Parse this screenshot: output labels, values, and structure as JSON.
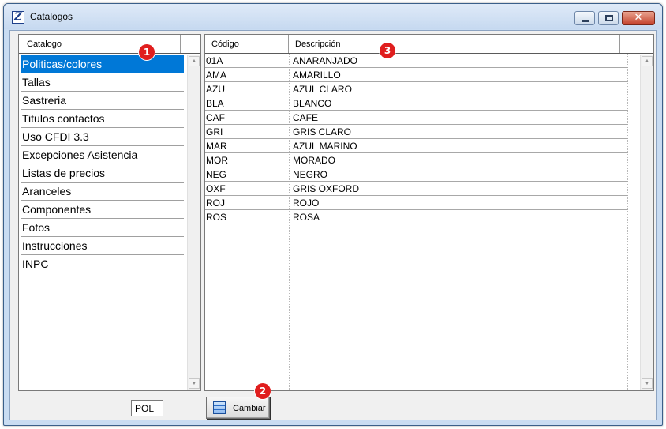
{
  "window": {
    "title": "Catalogos",
    "icon": "app-z-icon"
  },
  "left_panel": {
    "header": "Catalogo",
    "items": [
      "Politicas/colores",
      "Tallas",
      "Sastreria",
      "Titulos contactos",
      "Uso CFDI 3.3",
      "Excepciones Asistencia",
      "Listas de precios",
      "Aranceles",
      "Componentes",
      "Fotos",
      "Instrucciones",
      "INPC"
    ],
    "selected_index": 0
  },
  "grid": {
    "columns": [
      "Código",
      "Descripción"
    ],
    "rows": [
      [
        "01A",
        "ANARANJADO"
      ],
      [
        "AMA",
        "AMARILLO"
      ],
      [
        "AZU",
        "AZUL CLARO"
      ],
      [
        "BLA",
        "BLANCO"
      ],
      [
        "CAF",
        "CAFE"
      ],
      [
        "GRI",
        "GRIS CLARO"
      ],
      [
        "MAR",
        "AZUL MARINO"
      ],
      [
        "MOR",
        "MORADO"
      ],
      [
        "NEG",
        "NEGRO"
      ],
      [
        "OXF",
        "GRIS OXFORD"
      ],
      [
        "ROJ",
        "ROJO"
      ],
      [
        "ROS",
        "ROSA"
      ]
    ]
  },
  "footer": {
    "code_value": "POL",
    "cambiar_label": "Cambiar",
    "cambiar_icon": "grid-edit-icon"
  },
  "markers": [
    "1",
    "2",
    "3"
  ],
  "colors": {
    "selection": "#0078d7",
    "marker": "#e01e1e"
  }
}
